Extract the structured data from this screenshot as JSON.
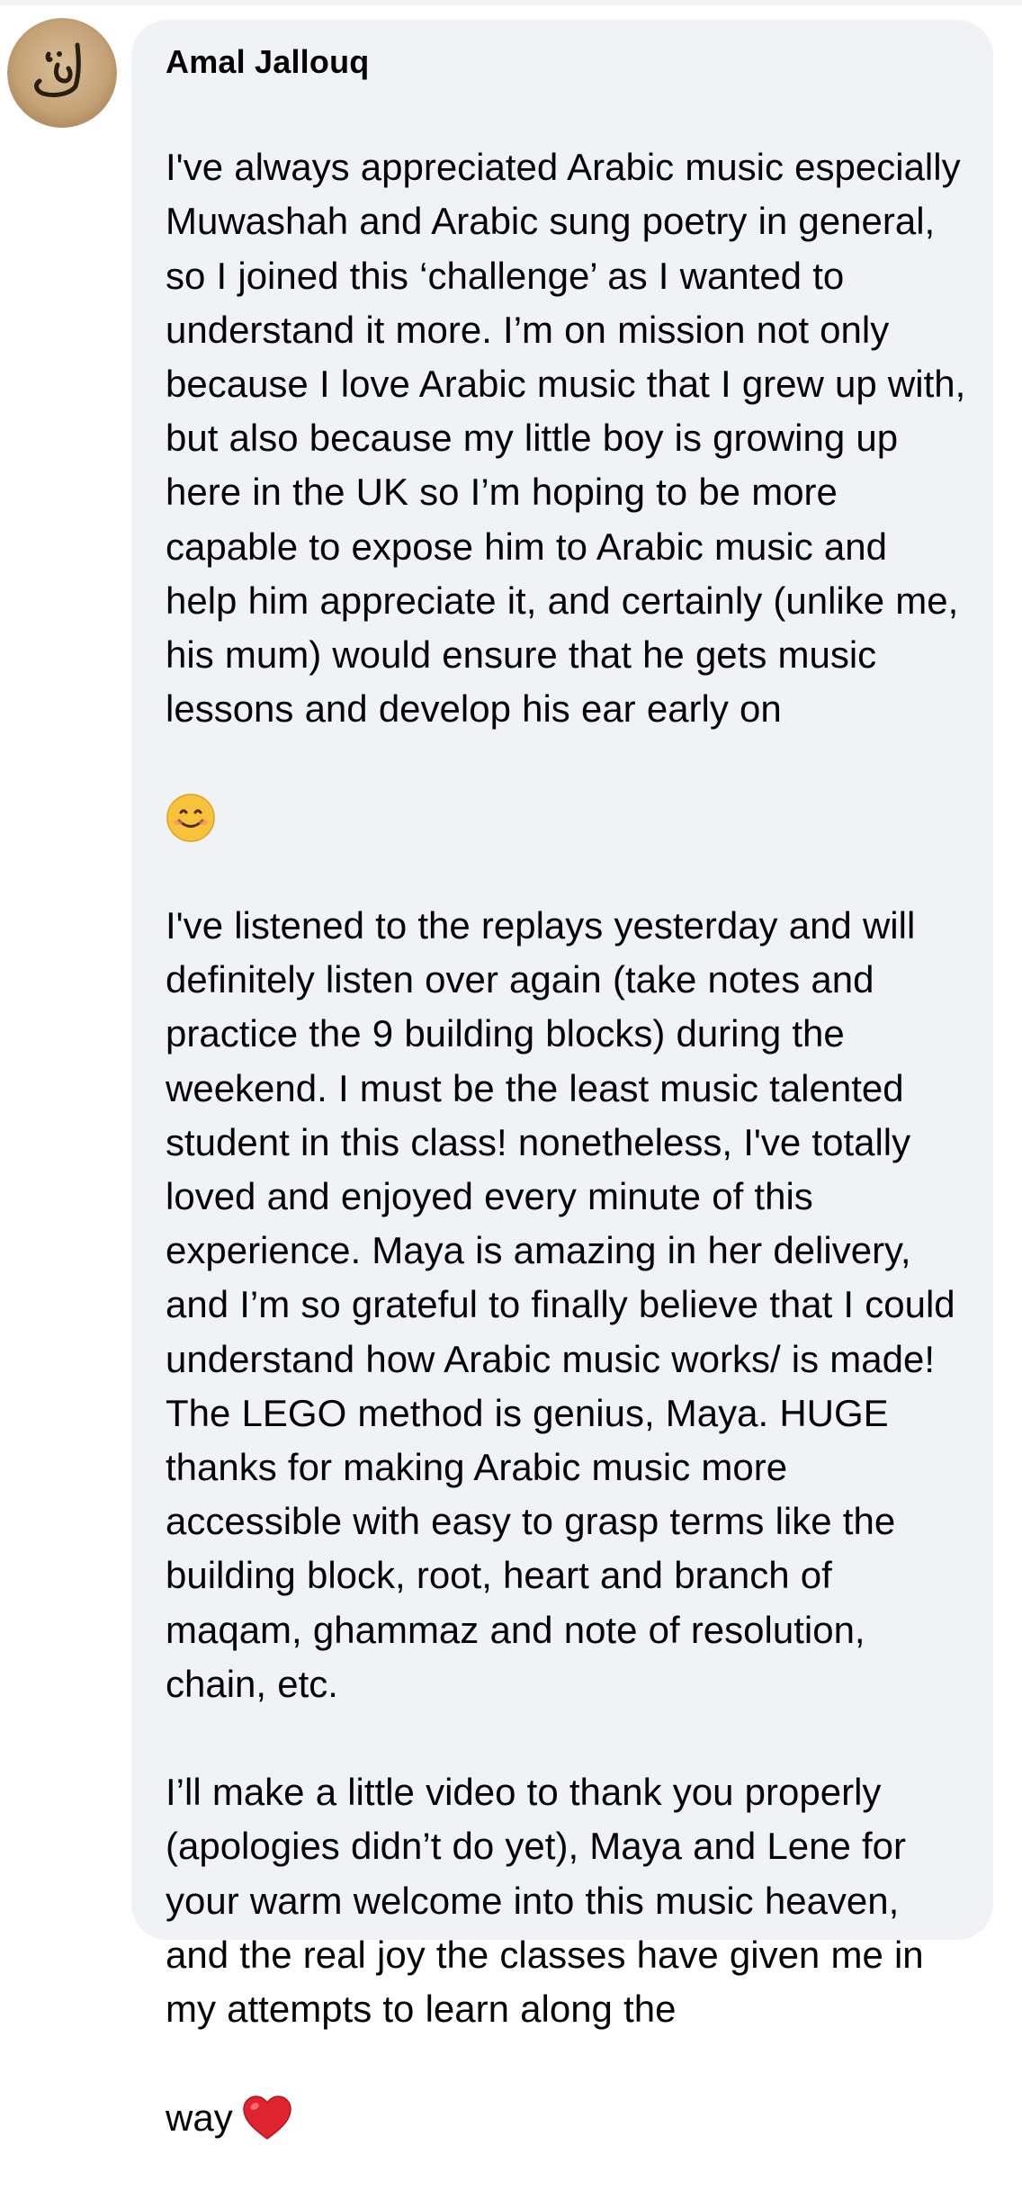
{
  "comment": {
    "author": "Amal Jallouq",
    "avatar": {
      "icon": "arabic-calligraphy-avatar",
      "background": "#c8a77c"
    },
    "paragraph_1": "I've always appreciated Arabic music especially Muwashah and Arabic sung poetry in general, so I joined this ‘challenge’ as I wanted to understand it more. I’m on mission not only because I love Arabic music that I grew up with, but also because my little boy is growing up here in the UK so I’m hoping to be more capable to expose him to Arabic music and help him appreciate it, and certainly (unlike me, his mum) would ensure that he gets music lessons and develop his ear early on",
    "emoji_1": "smiling-face-emoji",
    "paragraph_2": "I've listened to the replays yesterday and will definitely listen over again (take notes and practice the 9 building blocks) during the weekend. I must be the least music talented student in this class! nonetheless, I've totally loved and enjoyed every minute of this experience. Maya is amazing in her delivery, and I’m so grateful to finally believe that I could understand how Arabic music works/ is made! The LEGO method is genius, Maya. HUGE thanks for making Arabic music more accessible with easy to grasp terms like the building block, root, heart and branch of maqam, ghammaz and note of resolution, chain, etc.",
    "paragraph_3": "I’ll make a little video to thank you properly (apologies didn’t do yet), Maya and Lene for your warm welcome into this music heaven, and the real joy the classes have given me in my attempts to learn along the",
    "paragraph_3_end": "way",
    "emoji_2": "red-heart-emoji"
  },
  "colors": {
    "bubble": "#f0f2f5",
    "text": "#050505"
  }
}
